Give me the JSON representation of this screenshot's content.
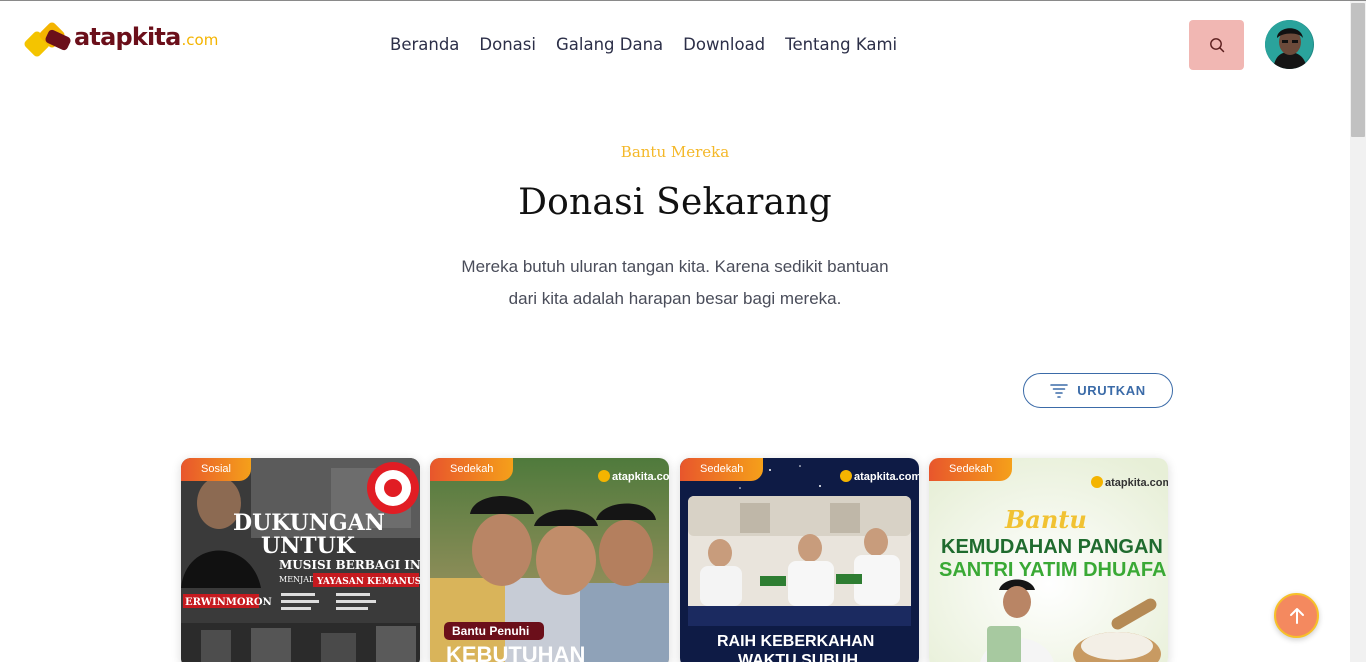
{
  "brand": {
    "name": "atapkita",
    "tld": ".com",
    "primary": "#6b0f1a",
    "accent": "#f4b400"
  },
  "nav": {
    "items": [
      "Beranda",
      "Donasi",
      "Galang Dana",
      "Download",
      "Tentang Kami"
    ]
  },
  "header": {
    "search_icon": "search-icon",
    "avatar": "user-avatar"
  },
  "hero": {
    "eyebrow": "Bantu Mereka",
    "title": "Donasi Sekarang",
    "subtitle_line1": "Mereka butuh uluran tangan kita. Karena sedikit bantuan",
    "subtitle_line2": "dari kita adalah harapan besar bagi mereka."
  },
  "sort": {
    "label": "URUTKAN",
    "icon": "filter-lines-icon"
  },
  "cards": [
    {
      "category": "Sosial",
      "img_line1": "DUKUNGAN",
      "img_line2": "UNTUK",
      "img_line3": "MUSISI BERBAGI INDONESIA",
      "img_line4": "MENJADI SEBUAH",
      "img_line5": "YAYASAN KEMANUSIAAN",
      "img_name": "ERWINMORON"
    },
    {
      "category": "Sedekah",
      "img_logo": "atapkita.com",
      "img_label": "Bantu Penuhi",
      "img_big": "KEBUTUHAN"
    },
    {
      "category": "Sedekah",
      "img_logo": "atapkita.com",
      "img_line1": "RAIH KEBERKAHAN",
      "img_line2": "WAKTU SUBUH"
    },
    {
      "category": "Sedekah",
      "img_logo": "atapkita.com",
      "img_line1": "Bantu",
      "img_line2": "KEMUDAHAN PANGAN",
      "img_line3": "SANTRI YATIM DHUAFA"
    }
  ],
  "scroll_top": {
    "icon": "arrow-up-icon"
  }
}
